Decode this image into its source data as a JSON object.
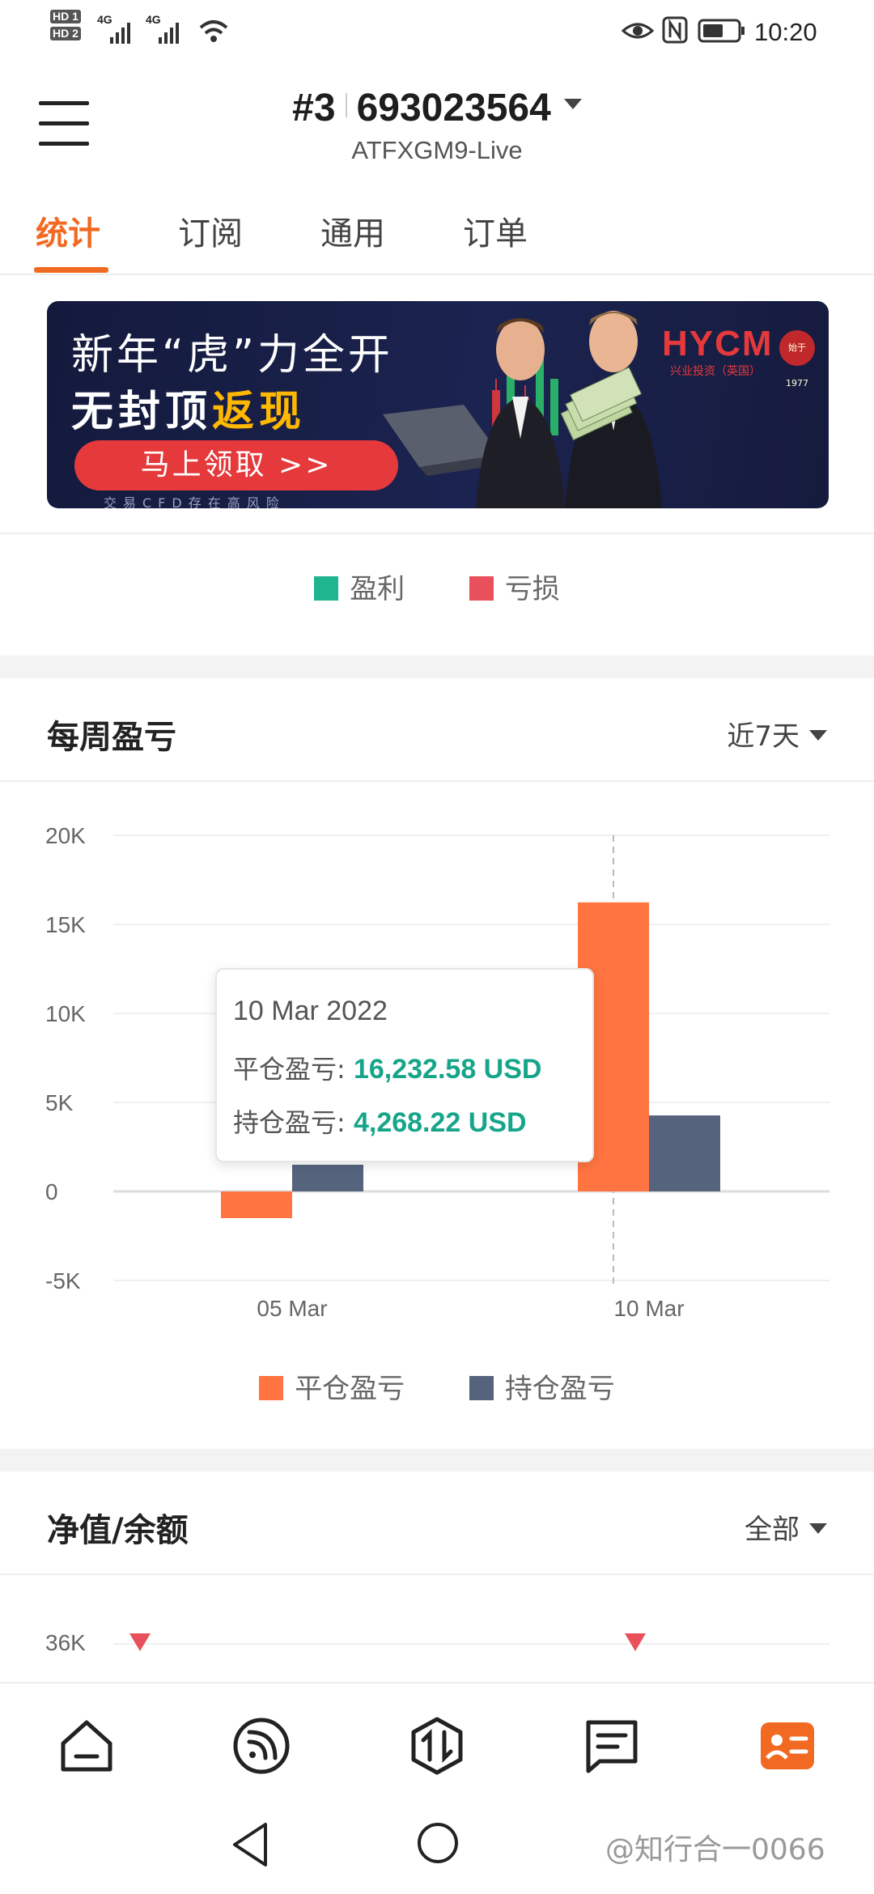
{
  "status_bar": {
    "time": "10:20",
    "hd1": "HD 1",
    "hd2": "HD 2",
    "net1": "4G",
    "net2": "4G",
    "icons": [
      "signal-icon",
      "wifi-icon",
      "eye-icon",
      "nfc-icon",
      "battery-icon"
    ]
  },
  "header": {
    "account_prefix": "#3",
    "account_number": "693023564",
    "server": "ATFXGM9-Live"
  },
  "tabs": [
    {
      "label": "统计",
      "active": true
    },
    {
      "label": "订阅",
      "active": false
    },
    {
      "label": "通用",
      "active": false
    },
    {
      "label": "订单",
      "active": false
    }
  ],
  "banner": {
    "line1": "新年“虎”力全开",
    "line2_a": "无封顶",
    "line2_b": "返现",
    "button": "马上领取 >>",
    "risk": "交易CFD存在高风险",
    "brand": "HYCM",
    "brand_sub": "兴业投资（英国）",
    "seal": "始于1977"
  },
  "profit_legend": {
    "profit": "盈利",
    "loss": "亏损",
    "profit_color": "#1fb58f",
    "loss_color": "#e8505b"
  },
  "weekly": {
    "title": "每周盈亏",
    "filter": "近7天"
  },
  "chart_data": {
    "type": "bar",
    "categories": [
      "05 Mar",
      "10 Mar"
    ],
    "series": [
      {
        "name": "平仓盈亏",
        "values": [
          -1500,
          16232.58
        ],
        "color": "#ff7441"
      },
      {
        "name": "持仓盈亏",
        "values": [
          1500,
          4268.22
        ],
        "color": "#55637d"
      }
    ],
    "yticks": [
      "20K",
      "15K",
      "10K",
      "5K",
      "0",
      "-5K"
    ],
    "ytick_values": [
      20000,
      15000,
      10000,
      5000,
      0,
      -5000
    ],
    "ylim": [
      -5000,
      20000
    ],
    "grid": true,
    "legend": "bottom",
    "highlight_category": "10 Mar"
  },
  "tooltip": {
    "date": "10 Mar 2022",
    "closed_label": "平仓盈亏:",
    "closed_value": "16,232.58 USD",
    "open_label": "持仓盈亏:",
    "open_value": "4,268.22 USD"
  },
  "equity": {
    "title": "净值/余额",
    "filter": "全部",
    "first_tick": "36K"
  },
  "bottom_nav": [
    {
      "name": "home-icon",
      "active": false
    },
    {
      "name": "signal-feed-icon",
      "active": false
    },
    {
      "name": "trade-icon",
      "active": false
    },
    {
      "name": "news-icon",
      "active": false
    },
    {
      "name": "account-icon",
      "active": true
    }
  ],
  "watermark": "@知行合一0066",
  "accent_color": "#f26a21"
}
